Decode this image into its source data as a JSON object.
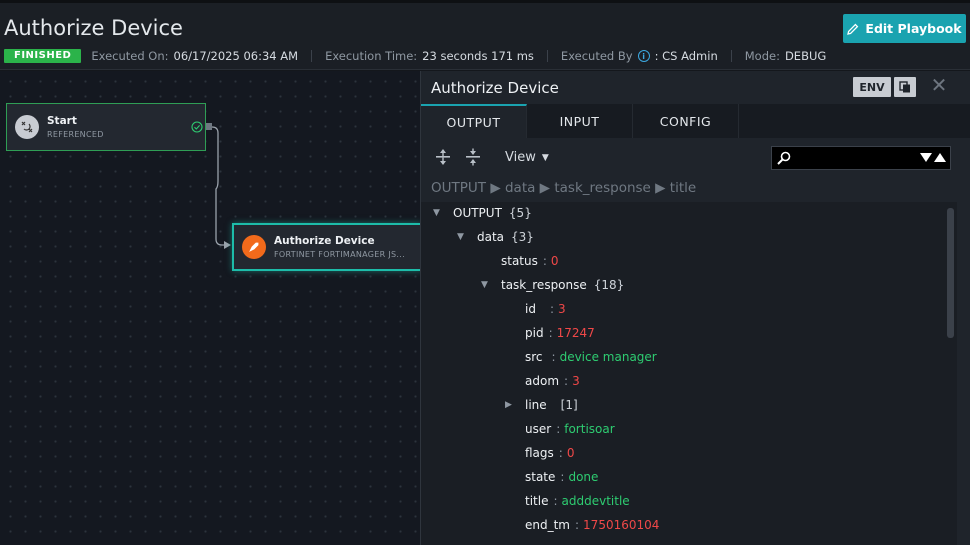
{
  "header": {
    "title": "Authorize Device",
    "edit_label": "Edit Playbook",
    "status": "FINISHED",
    "executed_on_label": "Executed On:",
    "executed_on": "06/17/2025 06:34 AM",
    "execution_time_label": "Execution Time:",
    "execution_time": "23 seconds 171 ms",
    "executed_by_label": "Executed By",
    "executed_by": ": CS Admin",
    "mode_label": "Mode:",
    "mode": "DEBUG"
  },
  "nodes": {
    "start": {
      "title": "Start",
      "sub": "REFERENCED"
    },
    "auth": {
      "title": "Authorize Device",
      "sub": "FORTINET FORTIMANAGER JS..."
    }
  },
  "panel": {
    "title": "Authorize Device",
    "env_label": "ENV",
    "tabs": [
      "OUTPUT",
      "INPUT",
      "CONFIG"
    ],
    "view_label": "View",
    "search_value": "",
    "breadcrumb": "OUTPUT ▶ data ▶ task_response ▶ title"
  },
  "tree": {
    "output": {
      "key": "OUTPUT",
      "count": "{5}"
    },
    "data": {
      "key": "data",
      "count": "{3}"
    },
    "status": {
      "key": "status",
      "value": "0"
    },
    "task_response": {
      "key": "task_response",
      "count": "{18}"
    },
    "id": {
      "key": "id",
      "value": "3"
    },
    "pid": {
      "key": "pid",
      "value": "17247"
    },
    "src": {
      "key": "src",
      "value": "device manager"
    },
    "adom": {
      "key": "adom",
      "value": "3"
    },
    "line": {
      "key": "line",
      "count": "[1]"
    },
    "user": {
      "key": "user",
      "value": "fortisoar"
    },
    "flags": {
      "key": "flags",
      "value": "0"
    },
    "state": {
      "key": "state",
      "value": "done"
    },
    "title": {
      "key": "title",
      "value": "adddevtitle"
    },
    "end_tm": {
      "key": "end_tm",
      "value": "1750160104"
    }
  },
  "colors": {
    "accent": "#1aa3b0",
    "success": "#2bb34a",
    "number": "#f04848",
    "string": "#2ecc71",
    "node_orange": "#f26a1b"
  }
}
